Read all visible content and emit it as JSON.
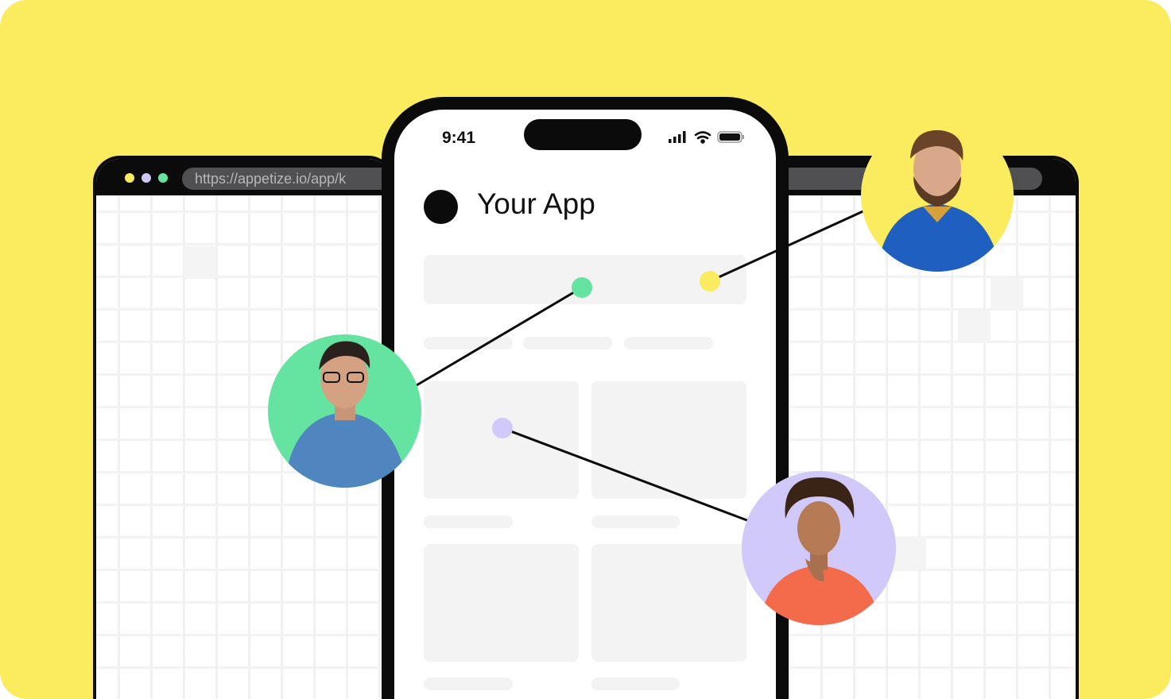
{
  "browser": {
    "url": "https://appetize.io/app/k",
    "traffic_lights": [
      "#FBEB5F",
      "#CFC6FB",
      "#64E3A1"
    ]
  },
  "phone": {
    "time": "9:41",
    "app_title": "Your App"
  },
  "colors": {
    "background": "#FBEB5F",
    "green": "#64E3A1",
    "yellow": "#FBEB5F",
    "purple": "#D2C9FB"
  },
  "avatars": [
    {
      "name": "avatar-man-glasses",
      "color": "#64E3A1"
    },
    {
      "name": "avatar-man-beard",
      "color": "#FBEB5F"
    },
    {
      "name": "avatar-woman",
      "color": "#D2C9FB"
    }
  ]
}
